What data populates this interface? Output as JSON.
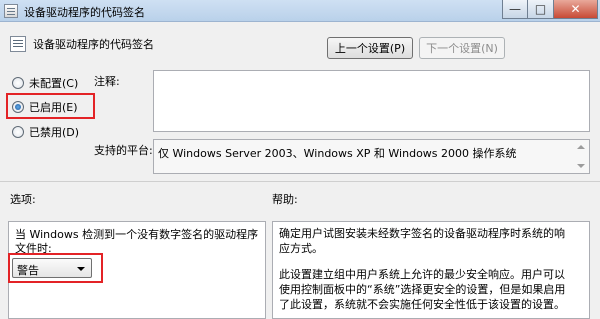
{
  "window": {
    "title": "设备驱动程序的代码签名",
    "icon": "policy-icon",
    "controls": {
      "minimize": "—",
      "maximize": "□",
      "close": "✕"
    }
  },
  "header": {
    "title": "设备驱动程序的代码签名",
    "prev_button": "上一个设置(P)",
    "next_button": "下一个设置(N)"
  },
  "state": {
    "options": [
      {
        "label": "未配置(C)",
        "checked": false
      },
      {
        "label": "已启用(E)",
        "checked": true
      },
      {
        "label": "已禁用(D)",
        "checked": false
      }
    ]
  },
  "comment": {
    "label": "注释:",
    "value": ""
  },
  "platform": {
    "label": "支持的平台:",
    "value": "仅 Windows Server 2003、Windows XP 和 Windows 2000 操作系统"
  },
  "options_section": {
    "label": "选项:",
    "description": "当 Windows 检测到一个没有数字签名的驱动程序文件时:",
    "dropdown_value": "警告"
  },
  "help_section": {
    "label": "帮助:",
    "paragraph1": "确定用户试图安装未经数字签名的设备驱动程序时系统的响应方式。",
    "paragraph2": "此设置建立组中用户系统上允许的最少安全响应。用户可以使用控制面板中的“系统”选择更安全的设置，但是如果启用了此设置，系统就不会实施任何安全性低于该设置的设置。"
  },
  "colors": {
    "highlight": "#e32326",
    "selection": "#1f5aa0"
  }
}
